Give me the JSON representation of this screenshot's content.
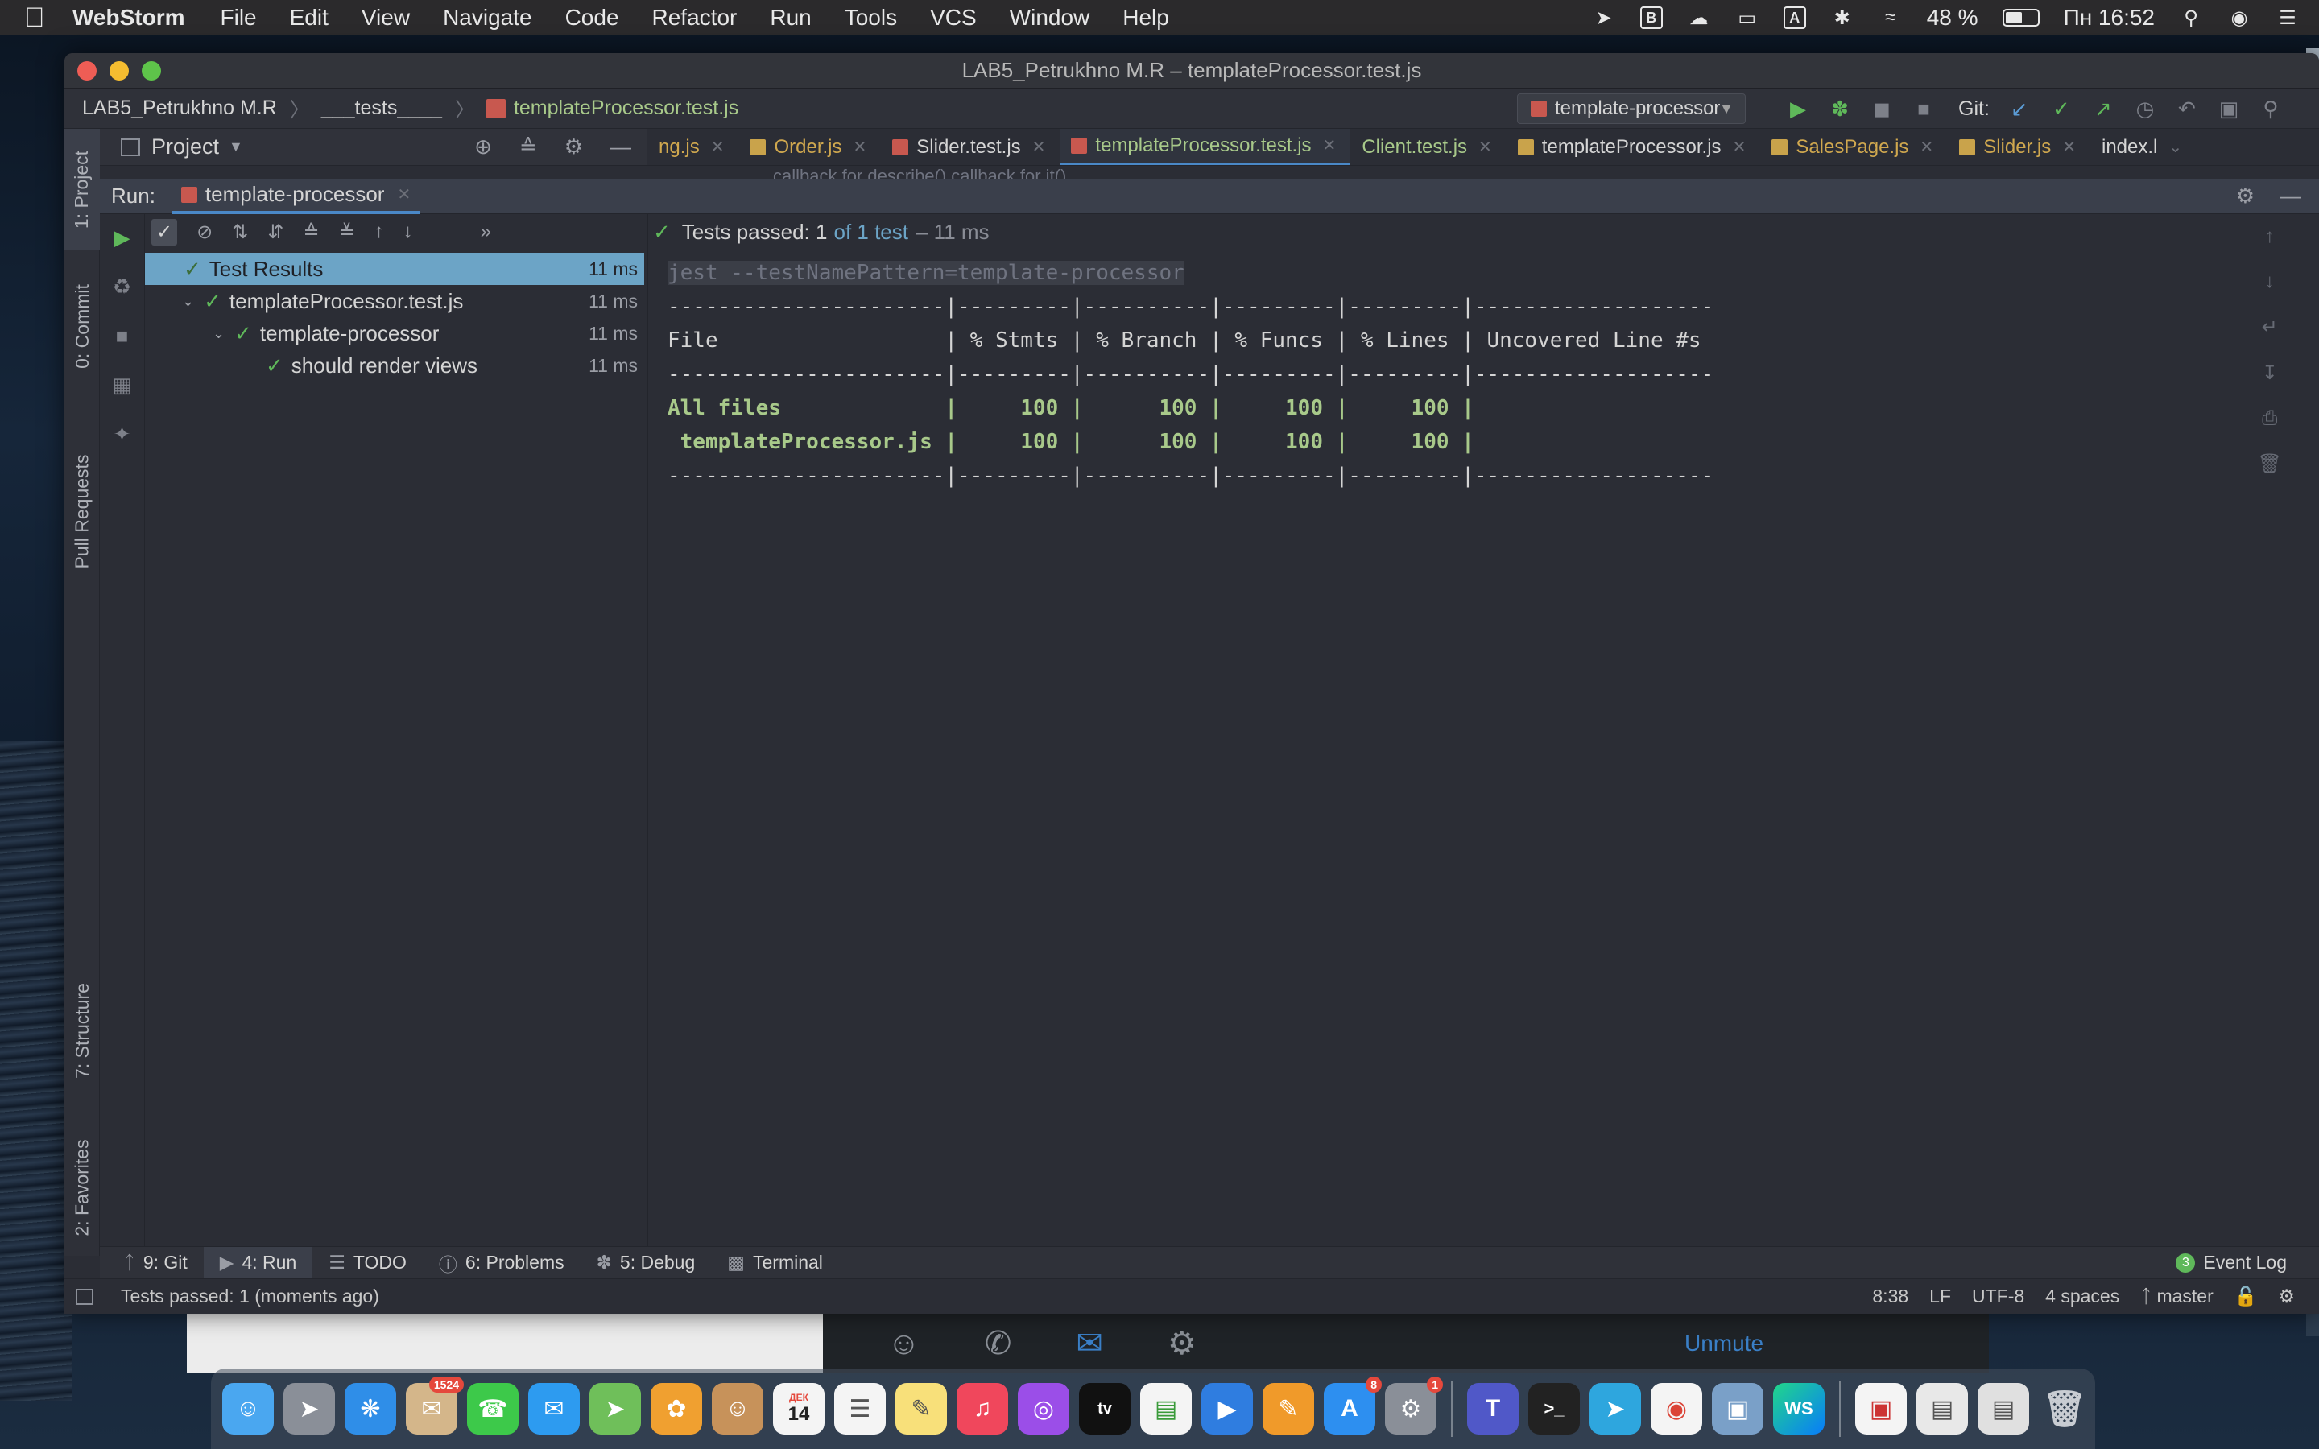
{
  "menubar": {
    "app_name": "WebStorm",
    "items": [
      "File",
      "Edit",
      "View",
      "Navigate",
      "Code",
      "Refactor",
      "Run",
      "Tools",
      "VCS",
      "Window",
      "Help"
    ],
    "battery": "48 %",
    "clock": "Пн 16:52",
    "input_source": "A"
  },
  "window": {
    "title": "LAB5_Petrukhno M.R – templateProcessor.test.js"
  },
  "navbar": {
    "project": "LAB5_Petrukhno M.R",
    "folder": "___tests____",
    "file": "templateProcessor.test.js",
    "run_config": "template-processor",
    "git_label": "Git:"
  },
  "left_stripe": {
    "project": "1: Project",
    "commit": "0: Commit",
    "pull_requests": "Pull Requests",
    "structure": "7: Structure",
    "favorites": "2: Favorites"
  },
  "project_panel": {
    "title": "Project"
  },
  "editor_tabs": [
    {
      "label": "ng.js",
      "kind": "js"
    },
    {
      "label": "Order.js",
      "kind": "js"
    },
    {
      "label": "Slider.test.js",
      "kind": "test"
    },
    {
      "label": "templateProcessor.test.js",
      "kind": "active"
    },
    {
      "label": "Client.test.js",
      "kind": "green"
    },
    {
      "label": "templateProcessor.js",
      "kind": "plain"
    },
    {
      "label": "SalesPage.js",
      "kind": "js"
    },
    {
      "label": "Slider.js",
      "kind": "js"
    },
    {
      "label": "index.l",
      "kind": "plain"
    }
  ],
  "ghost_text": "callback for describe()    callback for it()",
  "run": {
    "label": "Run:",
    "tab": "template-processor"
  },
  "test_tree": [
    {
      "label": "Test Results",
      "time": "11 ms",
      "level": 0,
      "selected": true
    },
    {
      "label": "templateProcessor.test.js",
      "time": "11 ms",
      "level": 1,
      "selected": false
    },
    {
      "label": "template-processor",
      "time": "11 ms",
      "level": 2,
      "selected": false
    },
    {
      "label": "should render views",
      "time": "11 ms",
      "level": 3,
      "selected": false
    }
  ],
  "console": {
    "status_prefix": "Tests passed:",
    "status_count": "1",
    "status_of": "of 1 test",
    "status_time": "– 11 ms",
    "command": "jest --testNamePattern=template-processor",
    "divider": "----------------------|---------|----------|---------|---------|-------------------",
    "header": "File                  | % Stmts | % Branch | % Funcs | % Lines | Uncovered Line #s",
    "rows": [
      "All files             |     100 |      100 |     100 |     100 |",
      " templateProcessor.js |     100 |      100 |     100 |     100 |"
    ]
  },
  "bottom_bar": {
    "git": "9: Git",
    "run": "4: Run",
    "todo": "TODO",
    "problems": "6: Problems",
    "debug": "5: Debug",
    "terminal": "Terminal",
    "event_log": "Event Log",
    "event_count": "3"
  },
  "status_bar": {
    "message": "Tests passed: 1 (moments ago)",
    "position": "8:38",
    "line_sep": "LF",
    "encoding": "UTF-8",
    "indent": "4 spaces",
    "branch": "master"
  },
  "background": {
    "unmute": "Unmute"
  },
  "dock": {
    "badges": {
      "mail": "1524",
      "calendar": "14",
      "calendar_month": "ДЕК",
      "appstore": "8",
      "prefs": "1"
    },
    "tv": "tv",
    "ws": "WS"
  },
  "colors": {
    "accent_blue": "#4a88c7",
    "pass_green": "#5fb85a",
    "coverage_green": "#a8c98a",
    "selection": "#6ca4c6"
  }
}
